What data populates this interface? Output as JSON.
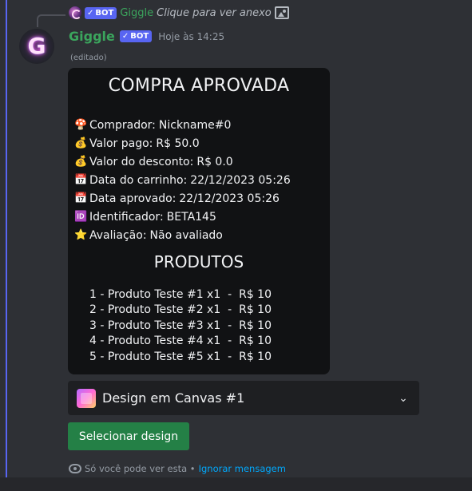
{
  "reply": {
    "bot_badge": "BOT",
    "author": "Giggle",
    "text": "Clique para ver anexo"
  },
  "message": {
    "author": "Giggle",
    "bot_badge": "BOT",
    "timestamp": "Hoje às 14:25",
    "edited": "(editado)"
  },
  "receipt": {
    "title": "COMPRA APROVADA",
    "info": [
      {
        "icon": "buyer-icon",
        "label": "Comprador:",
        "value": "Nickname#0"
      },
      {
        "icon": "money-icon",
        "label": "Valor pago:",
        "value": "R$ 50.0"
      },
      {
        "icon": "money-icon",
        "label": "Valor do desconto:",
        "value": "R$ 0.0"
      },
      {
        "icon": "calendar-icon",
        "label": "Data do carrinho:",
        "value": "22/12/2023 05:26"
      },
      {
        "icon": "calendar-icon",
        "label": "Data aprovado:",
        "value": "22/12/2023 05:26"
      },
      {
        "icon": "id-icon",
        "label": "Identificador:",
        "value": "BETA145"
      },
      {
        "icon": "star-icon",
        "label": "Avaliação:",
        "value": "Não avaliado"
      }
    ],
    "products_title": "PRODUTOS",
    "products": [
      "1 - Produto Teste #1 x1  -  R$ 10",
      "2 - Produto Teste #2 x1  -  R$ 10",
      "3 - Produto Teste #3 x1  -  R$ 10",
      "4 - Produto Teste #4 x1  -  R$ 10",
      "5 - Produto Teste #5 x1  -  R$ 10"
    ]
  },
  "select_menu": {
    "selected": "Design em Canvas #1"
  },
  "button": {
    "label": "Selecionar design"
  },
  "ephemeral": {
    "text": "Só você pode ver esta •",
    "dismiss": "Ignorar mensagem"
  },
  "colors": {
    "accent": "#5865f2",
    "author": "#3ba55d",
    "button": "#248046",
    "link": "#00a8fc"
  }
}
